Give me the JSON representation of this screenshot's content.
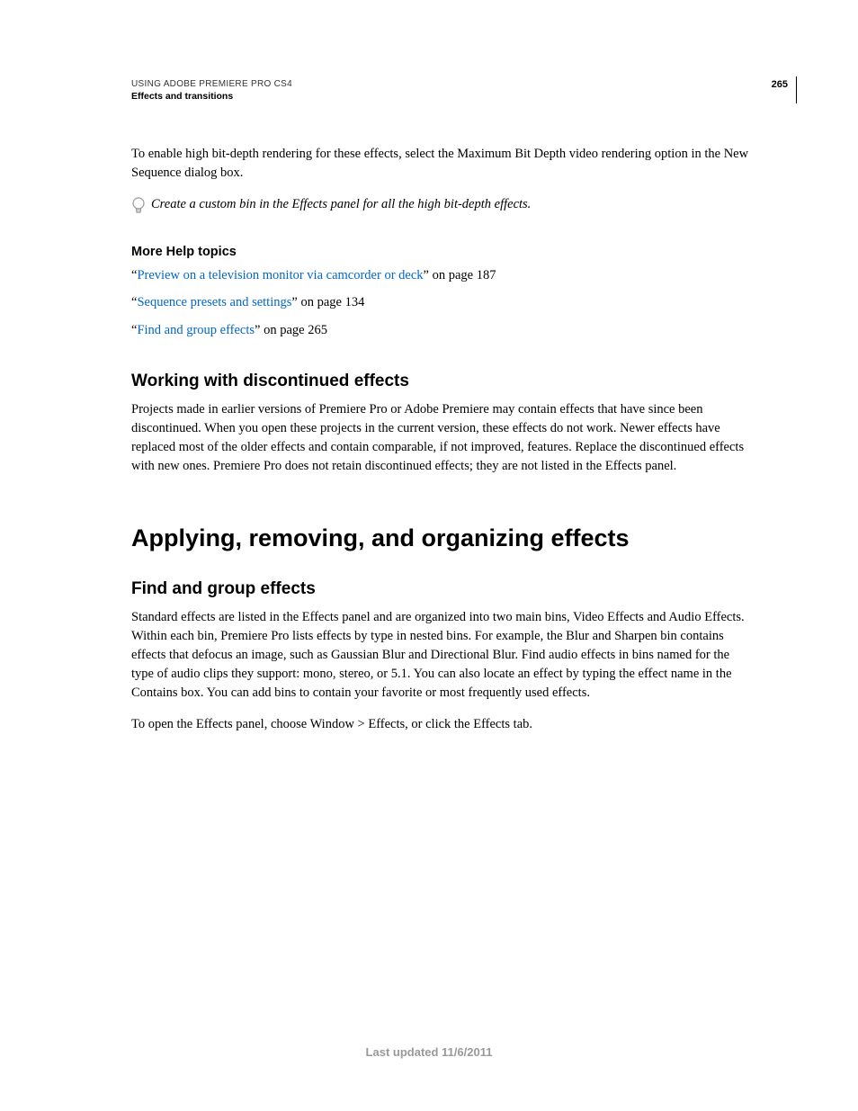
{
  "header": {
    "breadcrumb": "USING ADOBE PREMIERE PRO CS4",
    "section": "Effects and transitions",
    "page_number": "265"
  },
  "intro": {
    "paragraph": "To enable high bit-depth rendering for these effects, select the Maximum Bit Depth video rendering option in the New Sequence dialog box.",
    "tip": "Create a custom bin in the Effects panel for all the high bit-depth effects."
  },
  "more_help": {
    "heading": "More Help topics",
    "items": [
      {
        "quote_open": "“",
        "link": "Preview on a television monitor via camcorder or deck",
        "quote_close": "”",
        "suffix": " on page 187"
      },
      {
        "quote_open": "“",
        "link": "Sequence presets and settings",
        "quote_close": "”",
        "suffix": " on page 134"
      },
      {
        "quote_open": "“",
        "link": "Find and group effects",
        "quote_close": "”",
        "suffix": " on page 265"
      }
    ]
  },
  "section1": {
    "heading": "Working with discontinued effects",
    "paragraph": "Projects made in earlier versions of Premiere Pro or Adobe Premiere may contain effects that have since been discontinued. When you open these projects in the current version, these effects do not work. Newer effects have replaced most of the older effects and contain comparable, if not improved, features. Replace the discontinued effects with new ones. Premiere Pro does not retain discontinued effects; they are not listed in the Effects panel."
  },
  "main_heading": "Applying, removing, and organizing effects",
  "section2": {
    "heading": "Find and group effects",
    "paragraph1": "Standard effects are listed in the Effects panel and are organized into two main bins, Video Effects and Audio Effects. Within each bin, Premiere Pro lists effects by type in nested bins. For example, the Blur and Sharpen bin contains effects that defocus an image, such as Gaussian Blur and Directional Blur. Find audio effects in bins named for the type of audio clips they support: mono, stereo, or 5.1. You can also locate an effect by typing the effect name in the Contains box. You can add bins to contain your favorite or most frequently used effects.",
    "paragraph2": "To open the Effects panel, choose Window > Effects, or click the Effects tab."
  },
  "footer": {
    "text": "Last updated 11/6/2011"
  }
}
